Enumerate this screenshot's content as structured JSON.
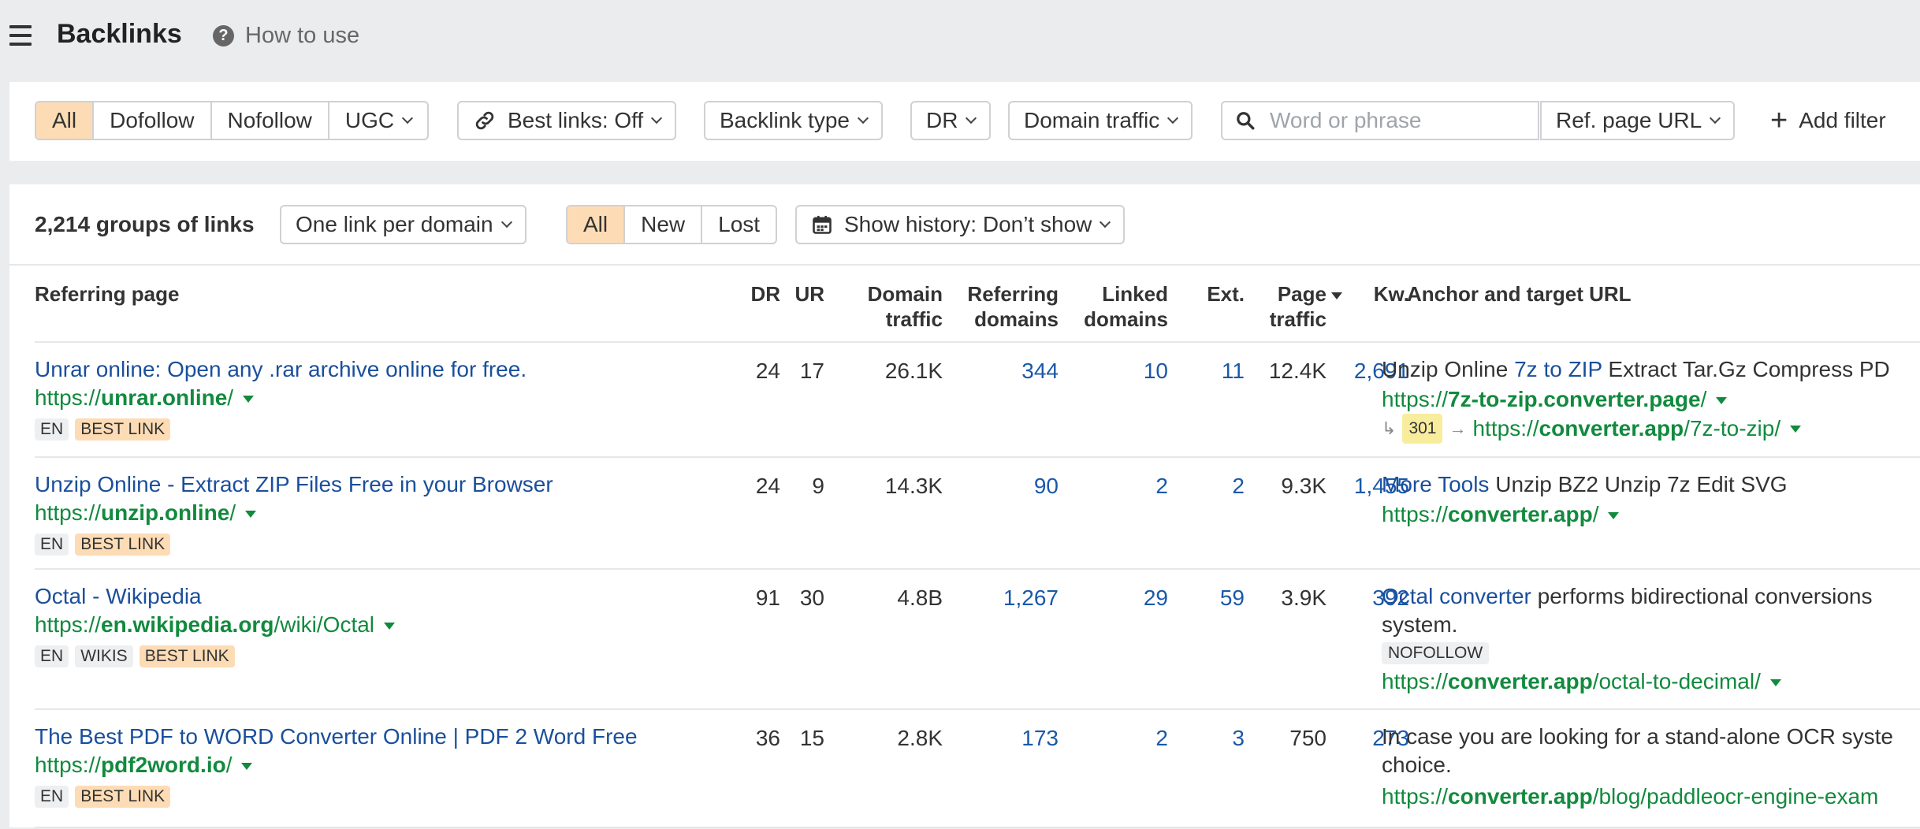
{
  "header": {
    "title": "Backlinks",
    "how_to_use": "How to use"
  },
  "filters": {
    "link_types": [
      "All",
      "Dofollow",
      "Nofollow",
      "UGC"
    ],
    "best_links": "Best links: Off",
    "backlink_type": "Backlink type",
    "dr": "DR",
    "domain_traffic": "Domain traffic",
    "search_placeholder": "Word or phrase",
    "search_value": "",
    "ref_page_url": "Ref. page URL",
    "add_filter": "Add filter"
  },
  "summary": {
    "count_label": "2,214 groups of links",
    "grouping": "One link per domain",
    "status_tabs": [
      "All",
      "New",
      "Lost"
    ],
    "history": "Show history: Don’t show"
  },
  "table": {
    "headers": {
      "referring_page": "Referring page",
      "dr": "DR",
      "ur": "UR",
      "domain_traffic_1": "Domain",
      "domain_traffic_2": "traffic",
      "referring_domains_1": "Referring",
      "referring_domains_2": "domains",
      "linked_domains_1": "Linked",
      "linked_domains_2": "domains",
      "ext": "Ext.",
      "page_traffic_1": "Page",
      "page_traffic_2": "traffic",
      "kw": "Kw.",
      "anchor": "Anchor and target URL"
    },
    "rows": [
      {
        "title": "Unrar online: Open any .rar archive online for free.",
        "url_prefix": "https://",
        "url_domain": "unrar.online",
        "url_path": "/",
        "tags": [
          "EN",
          "BEST LINK"
        ],
        "dr": "24",
        "ur": "17",
        "domain_traffic": "26.1K",
        "referring_domains": "344",
        "linked_domains": "10",
        "ext": "11",
        "page_traffic": "12.4K",
        "kw": "2,691",
        "anchor_before": "Unzip Online ",
        "anchor_link": "7z to ZIP",
        "anchor_after": " Extract Tar.Gz Compress PD",
        "target_prefix": "https://",
        "target_domain": "7z-to-zip.converter.page",
        "target_path": "/",
        "redirect_code": "301",
        "redirect_prefix": "https://",
        "redirect_domain": "converter.app",
        "redirect_path": "/7z-to-zip/"
      },
      {
        "title": "Unzip Online - Extract ZIP Files Free in your Browser",
        "url_prefix": "https://",
        "url_domain": "unzip.online",
        "url_path": "/",
        "tags": [
          "EN",
          "BEST LINK"
        ],
        "dr": "24",
        "ur": "9",
        "domain_traffic": "14.3K",
        "referring_domains": "90",
        "linked_domains": "2",
        "ext": "2",
        "page_traffic": "9.3K",
        "kw": "1,455",
        "anchor_before": "",
        "anchor_link": "More Tools",
        "anchor_after": " Unzip BZ2 Unzip 7z Edit SVG",
        "target_prefix": "https://",
        "target_domain": "converter.app",
        "target_path": "/"
      },
      {
        "title": "Octal - Wikipedia",
        "url_prefix": "https://",
        "url_domain": "en.wikipedia.org",
        "url_path": "/wiki/Octal",
        "tags": [
          "EN",
          "WIKIS",
          "BEST LINK"
        ],
        "dr": "91",
        "ur": "30",
        "domain_traffic": "4.8B",
        "referring_domains": "1,267",
        "linked_domains": "29",
        "ext": "59",
        "page_traffic": "3.9K",
        "kw": "392",
        "anchor_before": "",
        "anchor_link": "Octal converter",
        "anchor_after": " performs bidirectional conversions",
        "anchor_line2": "system.",
        "nofollow": "NOFOLLOW",
        "target_prefix": "https://",
        "target_domain": "converter.app",
        "target_path": "/octal-to-decimal/"
      },
      {
        "title": "The Best PDF to WORD Converter Online | PDF 2 Word Free",
        "url_prefix": "https://",
        "url_domain": "pdf2word.io",
        "url_path": "/",
        "tags": [
          "EN",
          "BEST LINK"
        ],
        "dr": "36",
        "ur": "15",
        "domain_traffic": "2.8K",
        "referring_domains": "173",
        "linked_domains": "2",
        "ext": "3",
        "page_traffic": "750",
        "kw": "273",
        "anchor_before": "In case you are looking for a stand-alone OCR syste",
        "anchor_link": "",
        "anchor_after": "",
        "anchor_line2": "choice.",
        "target_prefix": "https://",
        "target_domain": "converter.app",
        "target_path": "/blog/paddleocr-engine-exam"
      }
    ]
  }
}
